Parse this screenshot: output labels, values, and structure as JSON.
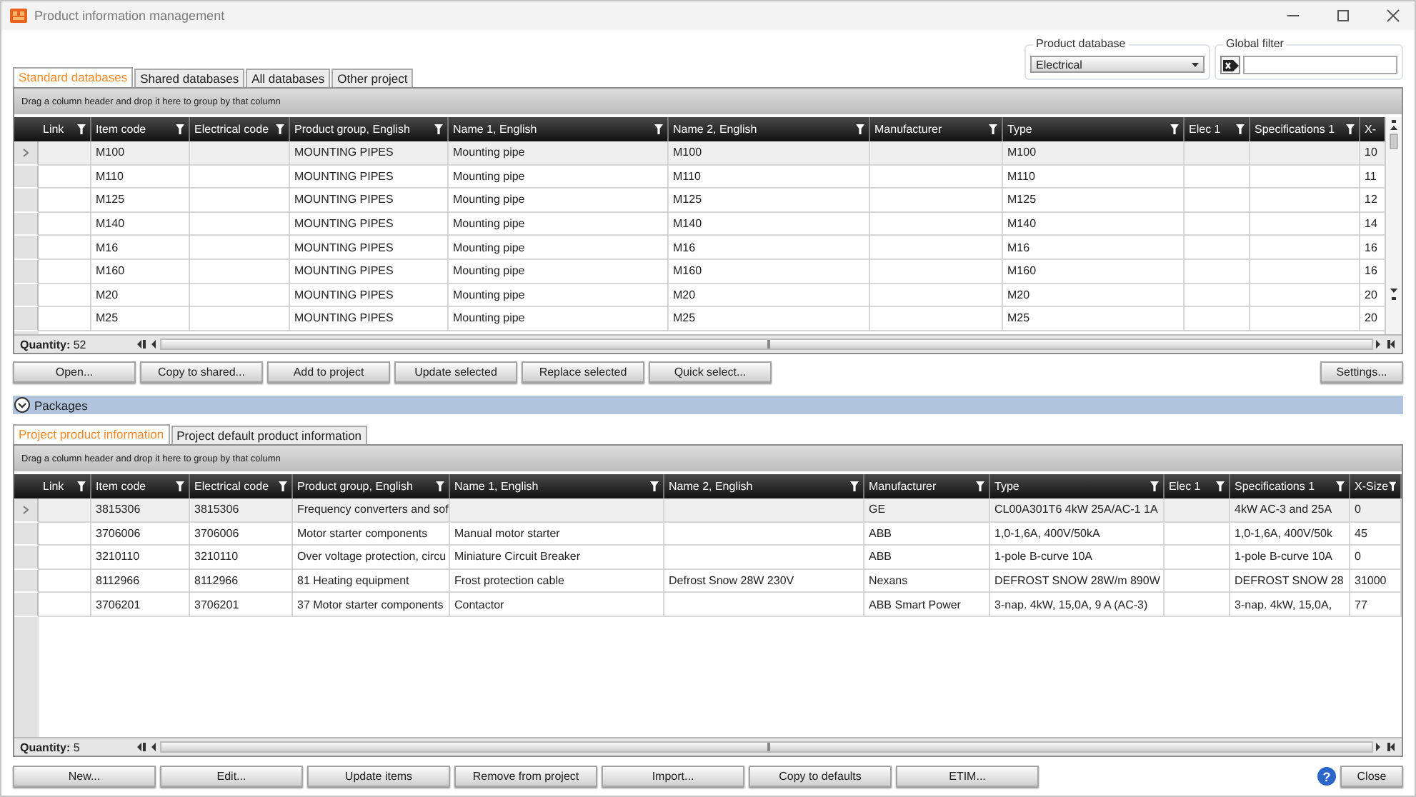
{
  "window": {
    "title": "Product information management"
  },
  "product_database": {
    "label": "Product database",
    "value": "Electrical"
  },
  "global_filter": {
    "label": "Global filter"
  },
  "database_tabs": [
    {
      "label": "Standard databases",
      "selected": true
    },
    {
      "label": "Shared databases",
      "selected": false
    },
    {
      "label": "All databases",
      "selected": false
    },
    {
      "label": "Other project",
      "selected": false
    }
  ],
  "standard_grid": {
    "group_hint": "Drag a column header and drop it here to group by that column",
    "columns": [
      {
        "label": "Link",
        "filter": true
      },
      {
        "label": "Item code",
        "filter": true
      },
      {
        "label": "Electrical code",
        "filter": true
      },
      {
        "label": "Product group, English",
        "filter": true
      },
      {
        "label": "Name 1, English",
        "filter": true
      },
      {
        "label": "Name 2, English",
        "filter": true
      },
      {
        "label": "Manufacturer",
        "filter": true
      },
      {
        "label": "Type",
        "filter": true
      },
      {
        "label": "Elec 1",
        "filter": true
      },
      {
        "label": "Specifications 1",
        "filter": true
      },
      {
        "label": "X-",
        "filter": false
      }
    ],
    "rows": [
      {
        "selected": true,
        "cells": [
          null,
          "M100",
          null,
          "MOUNTING PIPES",
          "Mounting pipe",
          "M100",
          null,
          "M100",
          null,
          null,
          "10"
        ]
      },
      {
        "selected": false,
        "cells": [
          null,
          "M110",
          null,
          "MOUNTING PIPES",
          "Mounting pipe",
          "M110",
          null,
          "M110",
          null,
          null,
          "11"
        ]
      },
      {
        "selected": false,
        "cells": [
          null,
          "M125",
          null,
          "MOUNTING PIPES",
          "Mounting pipe",
          "M125",
          null,
          "M125",
          null,
          null,
          "12"
        ]
      },
      {
        "selected": false,
        "cells": [
          null,
          "M140",
          null,
          "MOUNTING PIPES",
          "Mounting pipe",
          "M140",
          null,
          "M140",
          null,
          null,
          "14"
        ]
      },
      {
        "selected": false,
        "cells": [
          null,
          "M16",
          null,
          "MOUNTING PIPES",
          "Mounting pipe",
          "M16",
          null,
          "M16",
          null,
          null,
          "16"
        ]
      },
      {
        "selected": false,
        "cells": [
          null,
          "M160",
          null,
          "MOUNTING PIPES",
          "Mounting pipe",
          "M160",
          null,
          "M160",
          null,
          null,
          "16"
        ]
      },
      {
        "selected": false,
        "cells": [
          null,
          "M20",
          null,
          "MOUNTING PIPES",
          "Mounting pipe",
          "M20",
          null,
          "M20",
          null,
          null,
          "20"
        ]
      },
      {
        "selected": false,
        "cells": [
          null,
          "M25",
          null,
          "MOUNTING PIPES",
          "Mounting pipe",
          "M25",
          null,
          "M25",
          null,
          null,
          "20"
        ]
      }
    ],
    "quantity_label": "Quantity:",
    "quantity": "52"
  },
  "grid_buttons": [
    "Open...",
    "Copy to shared...",
    "Add to project",
    "Update selected",
    "Replace selected",
    "Quick select..."
  ],
  "settings_button": "Settings...",
  "packages": {
    "label": "Packages",
    "expanded": true
  },
  "project_tabs": [
    {
      "label": "Project product information",
      "selected": true
    },
    {
      "label": "Project default product information",
      "selected": false
    }
  ],
  "project_grid": {
    "group_hint": "Drag a column header and drop it here to group by that column",
    "columns": [
      {
        "label": "Link",
        "filter": true
      },
      {
        "label": "Item code",
        "filter": true
      },
      {
        "label": "Electrical code",
        "filter": true
      },
      {
        "label": "Product group, English",
        "filter": true
      },
      {
        "label": "Name 1, English",
        "filter": true
      },
      {
        "label": "Name 2, English",
        "filter": true
      },
      {
        "label": "Manufacturer",
        "filter": true
      },
      {
        "label": "Type",
        "filter": true
      },
      {
        "label": "Elec 1",
        "filter": true
      },
      {
        "label": "Specifications 1",
        "filter": true
      },
      {
        "label": "X-Size",
        "filter": true
      }
    ],
    "rows": [
      {
        "selected": true,
        "cells": [
          null,
          "3815306",
          "3815306",
          "Frequency converters and sof",
          null,
          null,
          "GE",
          "CL00A301T6 4kW 25A/AC-1 1A",
          null,
          "4kW AC-3 and 25A",
          "0"
        ]
      },
      {
        "selected": false,
        "cells": [
          null,
          "3706006",
          "3706006",
          "Motor starter components",
          "Manual motor starter",
          null,
          "ABB",
          "1,0-1,6A, 400V/50kA",
          null,
          "1,0-1,6A, 400V/50k",
          "45"
        ]
      },
      {
        "selected": false,
        "cells": [
          null,
          "3210110",
          "3210110",
          "Over voltage protection, circu",
          "Miniature Circuit Breaker",
          null,
          "ABB",
          "1-pole B-curve 10A",
          null,
          "1-pole B-curve 10A",
          "0"
        ]
      },
      {
        "selected": false,
        "cells": [
          null,
          "8112966",
          "8112966",
          "81 Heating equipment",
          "Frost protection cable",
          "Defrost Snow 28W 230V",
          "Nexans",
          "DEFROST SNOW 28W/m  890W",
          null,
          "DEFROST SNOW 28",
          "31000"
        ]
      },
      {
        "selected": false,
        "cells": [
          null,
          "3706201",
          "3706201",
          "37 Motor starter components",
          "Contactor",
          null,
          "ABB Smart Power",
          "3-nap. 4kW, 15,0A, 9 A (AC-3)",
          null,
          "3-nap. 4kW, 15,0A,",
          "77"
        ]
      }
    ],
    "quantity_label": "Quantity:",
    "quantity": "5"
  },
  "bottom_buttons": [
    "New...",
    "Edit...",
    "Update items",
    "Remove from project",
    "Import...",
    "Copy to defaults",
    "ETIM..."
  ],
  "help_button": "?",
  "close_button": "Close"
}
